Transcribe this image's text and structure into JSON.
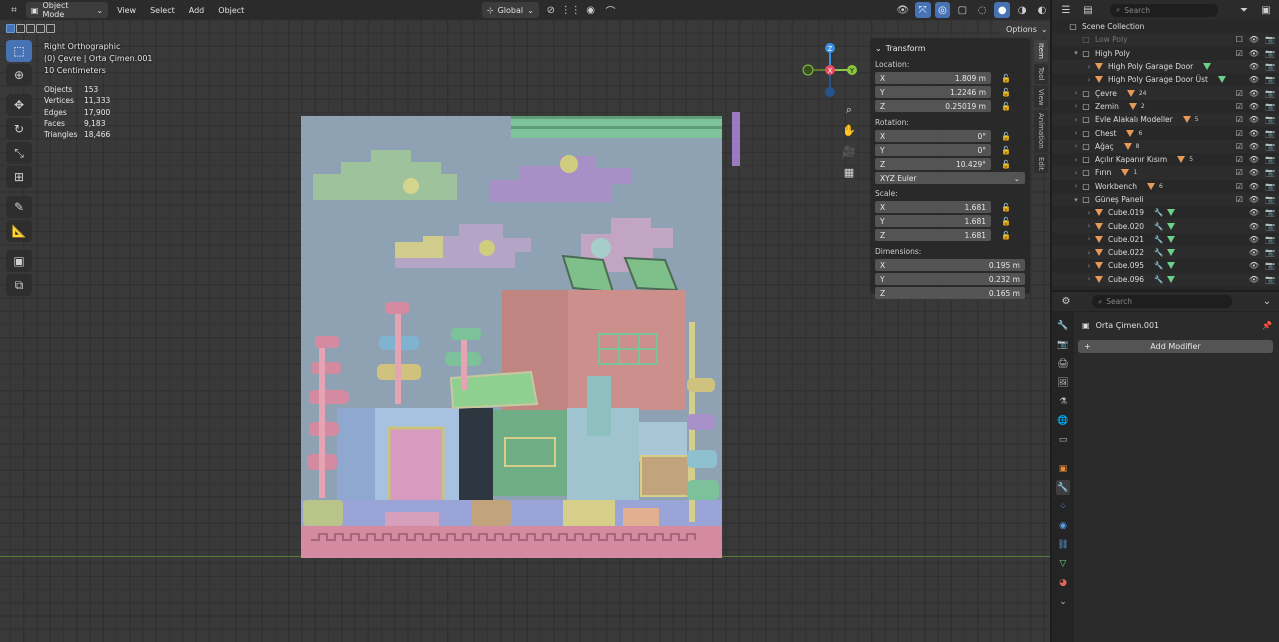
{
  "header": {
    "editor_icon": "viewport-icon",
    "mode": "Object Mode",
    "menus": [
      "View",
      "Select",
      "Add",
      "Object"
    ],
    "orientation": "Global",
    "options": "Options"
  },
  "overlay": {
    "view_name": "Right Orthographic",
    "context": "(0) Çevre | Orta Çimen.001",
    "scale": "10 Centimeters"
  },
  "stats": [
    {
      "k": "Objects",
      "v": "153"
    },
    {
      "k": "Vertices",
      "v": "11,333"
    },
    {
      "k": "Edges",
      "v": "17,900"
    },
    {
      "k": "Faces",
      "v": "9,183"
    },
    {
      "k": "Triangles",
      "v": "18,466"
    }
  ],
  "gizmo": {
    "z": "Z",
    "x": "X",
    "y": "Y"
  },
  "transform": {
    "title": "Transform",
    "location_label": "Location:",
    "location": [
      {
        "a": "X",
        "v": "1.809 m"
      },
      {
        "a": "Y",
        "v": "1.2246 m"
      },
      {
        "a": "Z",
        "v": "0.25019 m"
      }
    ],
    "rotation_label": "Rotation:",
    "rotation": [
      {
        "a": "X",
        "v": "0°"
      },
      {
        "a": "Y",
        "v": "0°"
      },
      {
        "a": "Z",
        "v": "10.429°"
      }
    ],
    "rotation_mode": "XYZ Euler",
    "scale_label": "Scale:",
    "scale": [
      {
        "a": "X",
        "v": "1.681"
      },
      {
        "a": "Y",
        "v": "1.681"
      },
      {
        "a": "Z",
        "v": "1.681"
      }
    ],
    "dimensions_label": "Dimensions:",
    "dimensions": [
      {
        "a": "X",
        "v": "0.195 m"
      },
      {
        "a": "Y",
        "v": "0.232 m"
      },
      {
        "a": "Z",
        "v": "0.165 m"
      }
    ]
  },
  "sidetabs": [
    "Item",
    "Tool",
    "View",
    "Animation",
    "Edit"
  ],
  "outliner": {
    "search_placeholder": "Search",
    "rows": [
      {
        "indent": 0,
        "exp": "",
        "name": "Scene Collection",
        "icon": "collection",
        "check": false,
        "dim": false
      },
      {
        "indent": 1,
        "exp": "",
        "name": "Low Poly",
        "icon": "collection",
        "check": false,
        "dim": true
      },
      {
        "indent": 1,
        "exp": "▾",
        "name": "High Poly",
        "icon": "collection",
        "check": true,
        "dim": false
      },
      {
        "indent": 2,
        "exp": "›",
        "name": "High Poly Garage Door",
        "icon": "mesh",
        "extra": "mesh",
        "check": false,
        "dim": false
      },
      {
        "indent": 2,
        "exp": "›",
        "name": "High Poly Garage Door Üst",
        "icon": "mesh",
        "extra": "mesh",
        "check": false,
        "dim": false
      },
      {
        "indent": 1,
        "exp": "›",
        "name": "Çevre",
        "icon": "collection",
        "extra": "24",
        "check": true,
        "dim": false
      },
      {
        "indent": 1,
        "exp": "›",
        "name": "Zemin",
        "icon": "collection",
        "extra": "2",
        "check": true,
        "dim": false
      },
      {
        "indent": 1,
        "exp": "›",
        "name": "Evle Alakalı Modeller",
        "icon": "collection",
        "extra": "5",
        "check": true,
        "dim": false
      },
      {
        "indent": 1,
        "exp": "›",
        "name": "Chest",
        "icon": "collection",
        "extra": "6",
        "check": true,
        "dim": false
      },
      {
        "indent": 1,
        "exp": "›",
        "name": "Ağaç",
        "icon": "collection",
        "extra": "8",
        "check": true,
        "dim": false
      },
      {
        "indent": 1,
        "exp": "›",
        "name": "Açılır Kapanır Kısım",
        "icon": "collection",
        "extra": "5",
        "check": true,
        "dim": false
      },
      {
        "indent": 1,
        "exp": "›",
        "name": "Fırın",
        "icon": "collection",
        "extra": "1",
        "check": true,
        "dim": false
      },
      {
        "indent": 1,
        "exp": "›",
        "name": "Workbench",
        "icon": "collection",
        "extra": "6",
        "check": true,
        "dim": false
      },
      {
        "indent": 1,
        "exp": "▾",
        "name": "Güneş Paneli",
        "icon": "collection",
        "check": true,
        "dim": false
      },
      {
        "indent": 2,
        "exp": "›",
        "name": "Cube.019",
        "icon": "mesh",
        "extra": "mod",
        "check": false,
        "dim": false
      },
      {
        "indent": 2,
        "exp": "›",
        "name": "Cube.020",
        "icon": "mesh",
        "extra": "mod",
        "check": false,
        "dim": false
      },
      {
        "indent": 2,
        "exp": "›",
        "name": "Cube.021",
        "icon": "mesh",
        "extra": "mod",
        "check": false,
        "dim": false
      },
      {
        "indent": 2,
        "exp": "›",
        "name": "Cube.022",
        "icon": "mesh",
        "extra": "mod",
        "check": false,
        "dim": false
      },
      {
        "indent": 2,
        "exp": "›",
        "name": "Cube.095",
        "icon": "mesh",
        "extra": "mod",
        "check": false,
        "dim": false
      },
      {
        "indent": 2,
        "exp": "›",
        "name": "Cube.096",
        "icon": "mesh",
        "extra": "mod",
        "check": false,
        "dim": false
      }
    ]
  },
  "properties": {
    "search_placeholder": "Search",
    "object_name": "Orta Çimen.001",
    "add_modifier": "Add Modifier"
  },
  "colors": {
    "accent": "#4772b3",
    "x_axis": "#e84a5f",
    "y_axis": "#8cc63f",
    "z_axis": "#3b8fe6"
  }
}
